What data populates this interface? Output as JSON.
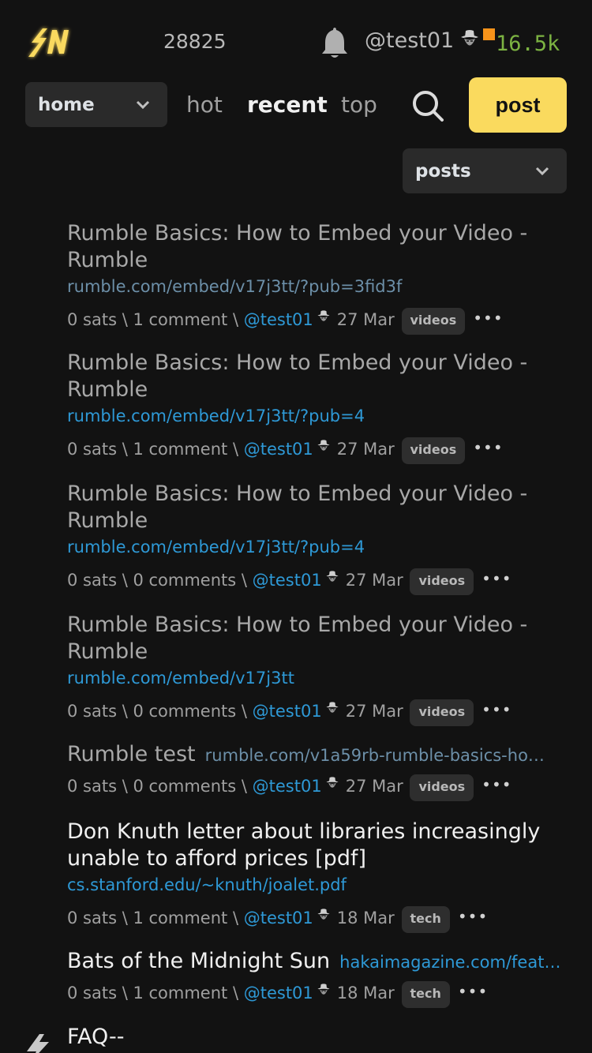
{
  "header": {
    "block_height": "28825",
    "username": "@test01",
    "balance": "16.5k"
  },
  "nav": {
    "sub_select": "home",
    "links": [
      "hot",
      "recent",
      "top"
    ],
    "post_label": "post",
    "type_select": "posts"
  },
  "items": [
    {
      "title": "Rumble Basics: How to Embed your Video - Rumble",
      "link": "rumble.com/embed/v17j3tt/?pub=3fid3f",
      "sats": "0 sats",
      "comments": "1 comment",
      "user": "@test01",
      "date": "27 Mar",
      "tag": "videos"
    },
    {
      "title": "Rumble Basics: How to Embed your Video - Rumble",
      "link": "rumble.com/embed/v17j3tt/?pub=4",
      "sats": "0 sats",
      "comments": "1 comment",
      "user": "@test01",
      "date": "27 Mar",
      "tag": "videos"
    },
    {
      "title": "Rumble Basics: How to Embed your Video - Rumble",
      "link": "rumble.com/embed/v17j3tt/?pub=4",
      "sats": "0 sats",
      "comments": "0 comments",
      "user": "@test01",
      "date": "27 Mar",
      "tag": "videos"
    },
    {
      "title": "Rumble Basics: How to Embed your Video - Rumble",
      "link": "rumble.com/embed/v17j3tt",
      "sats": "0 sats",
      "comments": "0 comments",
      "user": "@test01",
      "date": "27 Mar",
      "tag": "videos"
    },
    {
      "title": "Rumble test",
      "link": "rumble.com/v1a59rb-rumble-basics-ho…",
      "sats": "0 sats",
      "comments": "0 comments",
      "user": "@test01",
      "date": "27 Mar",
      "tag": "videos"
    },
    {
      "title": "Don Knuth letter about libraries increasingly unable to afford prices [pdf]",
      "link": "cs.stanford.edu/~knuth/joalet.pdf",
      "sats": "0 sats",
      "comments": "1 comment",
      "user": "@test01",
      "date": "18 Mar",
      "tag": "tech"
    },
    {
      "title": "Bats of the Midnight Sun",
      "link": "hakaimagazine.com/feat…",
      "sats": "0 sats",
      "comments": "1 comment",
      "user": "@test01",
      "date": "18 Mar",
      "tag": "tech"
    },
    {
      "title": "FAQ--"
    }
  ],
  "colors": {
    "background": "#121212",
    "accent_yellow": "#fada5e",
    "link_blue": "#2e99d6",
    "balance_green": "#7cb342",
    "bitcoin_orange": "#f7931a"
  },
  "icons": {
    "logo": "sn-logo",
    "bell": "bell-icon",
    "hat": "cowboy-hat-icon",
    "search": "search-icon",
    "chevron": "chevron-down-icon",
    "more": "more-icon"
  }
}
